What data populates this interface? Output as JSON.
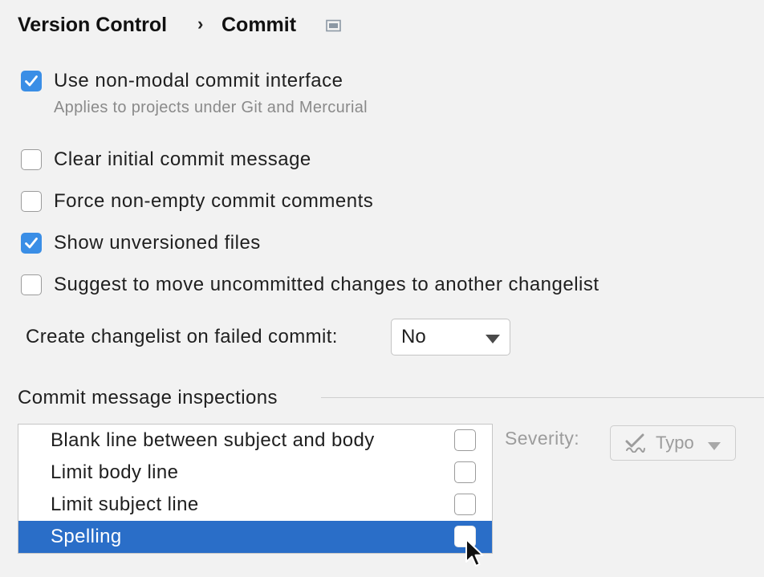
{
  "breadcrumb": {
    "parent": "Version Control",
    "separator": "›",
    "current": "Commit"
  },
  "options": {
    "non_modal": {
      "label": "Use non-modal commit interface",
      "checked": true,
      "hint": "Applies to projects under Git and Mercurial"
    },
    "clear_initial": {
      "label": "Clear initial commit message",
      "checked": false
    },
    "force_non_empty": {
      "label": "Force non-empty commit comments",
      "checked": false
    },
    "show_unversioned": {
      "label": "Show unversioned files",
      "checked": true
    },
    "suggest_move": {
      "label": "Suggest to move uncommitted changes to another changelist",
      "checked": false
    }
  },
  "changelist": {
    "label": "Create changelist on failed commit:",
    "value": "No"
  },
  "inspections": {
    "title": "Commit message inspections",
    "items": [
      {
        "label": "Blank line between subject and body",
        "checked": false,
        "selected": false
      },
      {
        "label": "Limit body line",
        "checked": false,
        "selected": false
      },
      {
        "label": "Limit subject line",
        "checked": false,
        "selected": false
      },
      {
        "label": "Spelling",
        "checked": false,
        "selected": true
      }
    ],
    "severity_label": "Severity:",
    "severity_value": "Typo",
    "severity_icon": "typo-icon"
  },
  "colors": {
    "accent": "#3a8ee6",
    "selection": "#2a6ec8",
    "background": "#f2f2f2"
  }
}
